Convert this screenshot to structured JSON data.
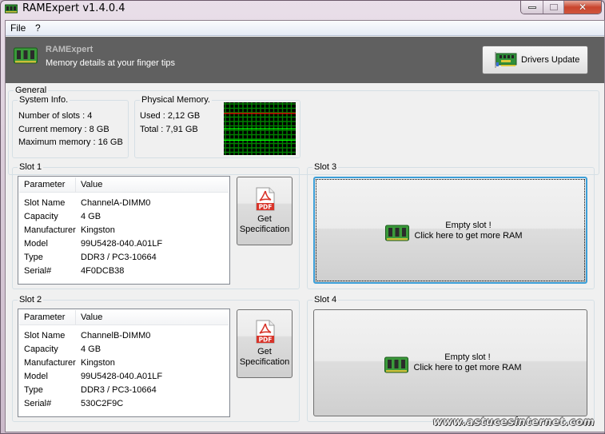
{
  "window": {
    "title": "RAMExpert v1.4.0.4",
    "controls": {
      "minimize": "minimize",
      "maximize": "maximize",
      "close": "✕"
    }
  },
  "menu": {
    "items": [
      "File",
      "?"
    ]
  },
  "banner": {
    "title": "RAMExpert",
    "subtitle": "Memory details at your finger tips",
    "drivers_button": "Drivers Update"
  },
  "general": {
    "legend": "General",
    "system_info": {
      "legend": "System Info.",
      "lines": [
        "Number of slots : 4",
        "Current memory : 8 GB",
        "Maximum memory : 16 GB"
      ]
    },
    "physical_memory": {
      "legend": "Physical Memory.",
      "used": "Used : 2,12 GB",
      "total": "Total : 7,91 GB",
      "graph": {
        "used_fraction": 0.27,
        "colors": {
          "grid": "#008000",
          "used_line": "#ff0000",
          "trace": "#00ff00",
          "background": "#000000"
        }
      }
    }
  },
  "table_headers": {
    "parameter": "Parameter",
    "value": "Value"
  },
  "slots": [
    {
      "legend": "Slot 1",
      "rows": [
        {
          "k": "Slot Name",
          "v": "ChannelA-DIMM0"
        },
        {
          "k": "Capacity",
          "v": "4 GB"
        },
        {
          "k": "Manufacturer",
          "v": "Kingston"
        },
        {
          "k": "Model",
          "v": "99U5428-040.A01LF"
        },
        {
          "k": "Type",
          "v": "DDR3 / PC3-10664"
        },
        {
          "k": "Serial#",
          "v": "4F0DCB38"
        }
      ],
      "spec_button": {
        "pdf": "PDF",
        "line1": "Get",
        "line2": "Specification"
      }
    },
    {
      "legend": "Slot 2",
      "rows": [
        {
          "k": "Slot Name",
          "v": "ChannelB-DIMM0"
        },
        {
          "k": "Capacity",
          "v": "4 GB"
        },
        {
          "k": "Manufacturer",
          "v": "Kingston"
        },
        {
          "k": "Model",
          "v": "99U5428-040.A01LF"
        },
        {
          "k": "Type",
          "v": "DDR3 / PC3-10664"
        },
        {
          "k": "Serial#",
          "v": "530C2F9C"
        }
      ],
      "spec_button": {
        "pdf": "PDF",
        "line1": "Get",
        "line2": "Specification"
      }
    },
    {
      "legend": "Slot 3",
      "empty": {
        "line1": "Empty slot !",
        "line2": "Click here to get more RAM"
      }
    },
    {
      "legend": "Slot 4",
      "empty": {
        "line1": "Empty slot !",
        "line2": "Click here to get more RAM"
      }
    }
  ],
  "watermark": "www.astucesinternet.com"
}
